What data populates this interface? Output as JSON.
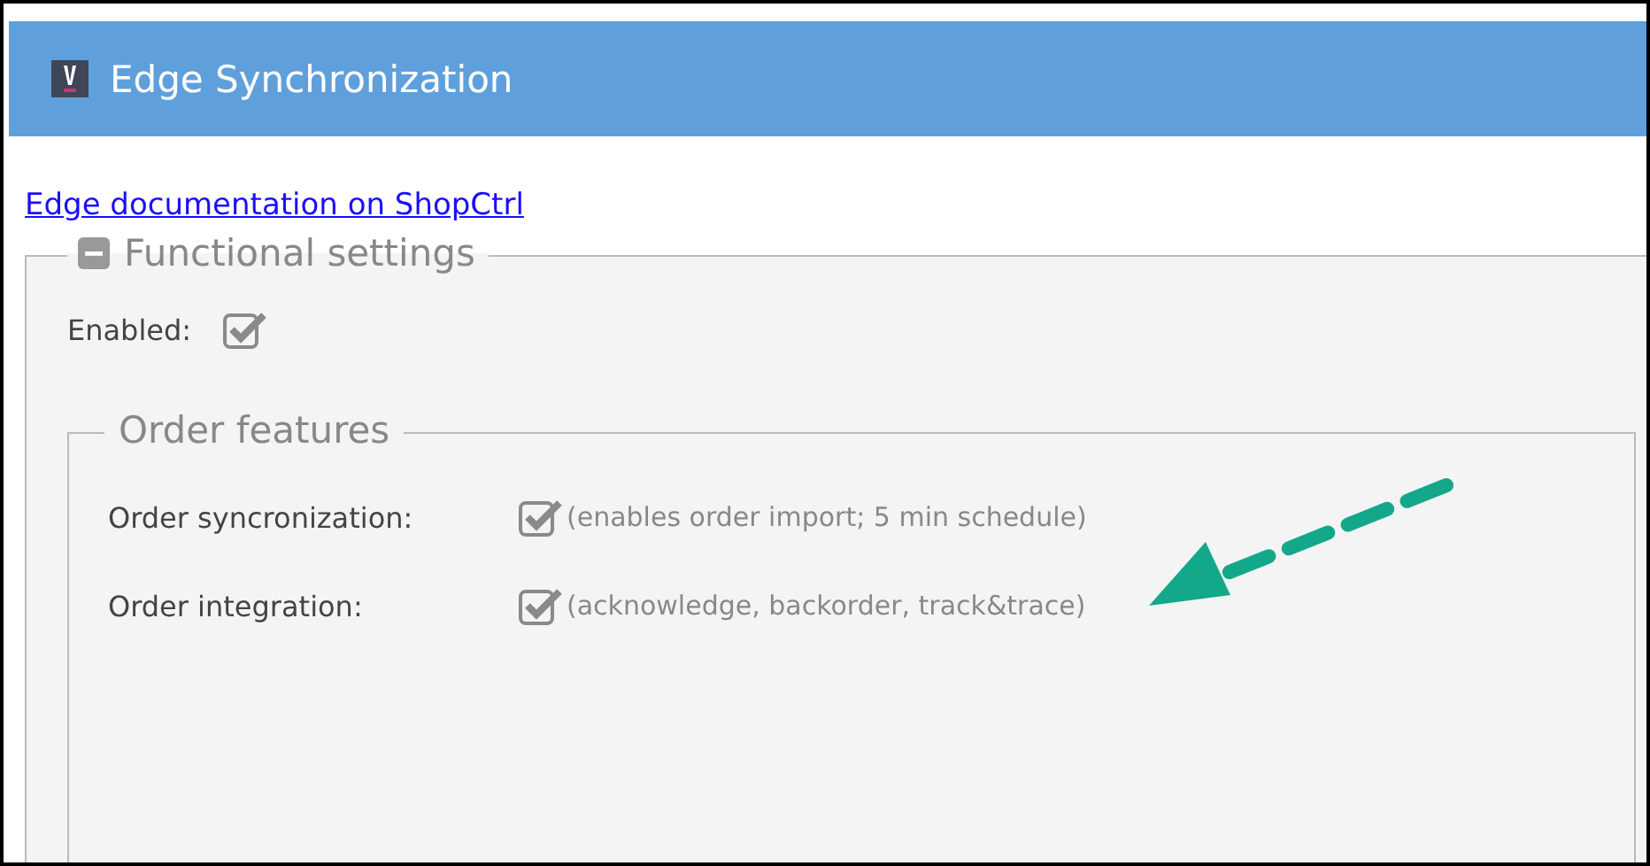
{
  "header": {
    "title": "Edge Synchronization"
  },
  "link": "Edge documentation on ShopCtrl",
  "functional_settings": {
    "legend": "Functional settings",
    "expanded": true,
    "enabled": {
      "label": "Enabled:",
      "checked": true
    }
  },
  "order_features": {
    "legend": "Order features",
    "rows": [
      {
        "label": "Order syncronization:",
        "checked": true,
        "note": "(enables order import; 5 min schedule)"
      },
      {
        "label": "Order integration:",
        "checked": true,
        "note": "(acknowledge, backorder, track&trace)"
      }
    ]
  }
}
